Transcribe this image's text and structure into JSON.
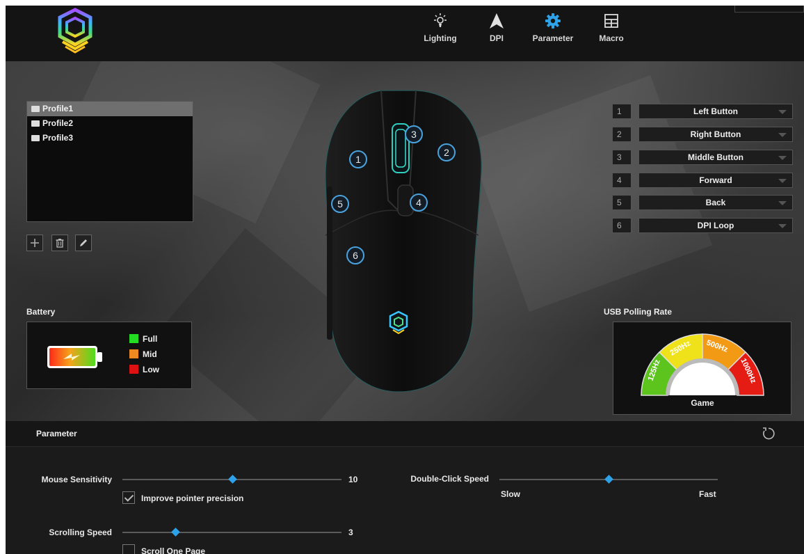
{
  "nav": [
    {
      "label": "Lighting",
      "icon": "lighting-icon"
    },
    {
      "label": "DPI",
      "icon": "dpi-arrow-icon"
    },
    {
      "label": "Parameter",
      "icon": "gear-icon",
      "active": true
    },
    {
      "label": "Macro",
      "icon": "grid-icon"
    }
  ],
  "profiles": {
    "items": [
      "Profile1",
      "Profile2",
      "Profile3"
    ],
    "selected": "Profile1"
  },
  "battery": {
    "title": "Battery",
    "legend": [
      {
        "label": "Full",
        "color": "#22dd22"
      },
      {
        "label": "Mid",
        "color": "#f08a20"
      },
      {
        "label": "Low",
        "color": "#dd1111"
      }
    ]
  },
  "mouse": {
    "badges": [
      "1",
      "2",
      "3",
      "4",
      "5",
      "6"
    ]
  },
  "button_assignments": [
    {
      "num": "1",
      "value": "Left Button"
    },
    {
      "num": "2",
      "value": "Right Button"
    },
    {
      "num": "3",
      "value": "Middle Button"
    },
    {
      "num": "4",
      "value": "Forward"
    },
    {
      "num": "5",
      "value": "Back"
    },
    {
      "num": "6",
      "value": "DPI Loop"
    }
  ],
  "usb": {
    "title": "USB Polling Rate",
    "rates": [
      "125Hz",
      "250Hz",
      "500Hz",
      "1000Hz"
    ],
    "mode": "Game"
  },
  "parameter": {
    "title": "Parameter",
    "mouse_sensitivity": {
      "label": "Mouse Sensitivity",
      "value": "10",
      "level": 0.5
    },
    "improve_precision": {
      "label": "Improve pointer precision",
      "checked": true
    },
    "scrolling_speed": {
      "label": "Scrolling Speed",
      "value": "3",
      "level": 0.24
    },
    "scroll_one_page": {
      "label": "Scroll One Page",
      "checked": false
    },
    "double_click": {
      "label": "Double-Click Speed",
      "slow": "Slow",
      "fast": "Fast",
      "level": 0.5
    }
  },
  "colors": {
    "accent": "#2ea2e8",
    "mouse_glow": "#2fd0c0"
  }
}
